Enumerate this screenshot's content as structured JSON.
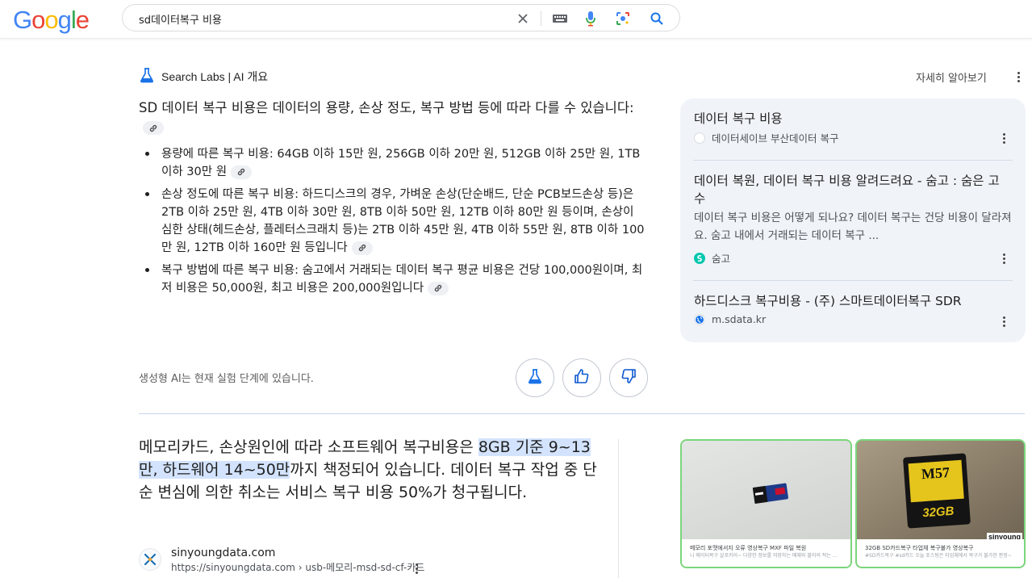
{
  "header": {
    "logo": [
      {
        "ch": "G",
        "color": "#4285F4"
      },
      {
        "ch": "o",
        "color": "#EA4335"
      },
      {
        "ch": "o",
        "color": "#FBBC05"
      },
      {
        "ch": "g",
        "color": "#4285F4"
      },
      {
        "ch": "l",
        "color": "#34A853"
      },
      {
        "ch": "e",
        "color": "#EA4335"
      }
    ],
    "search_query": "sd데이터복구 비용",
    "icons": [
      "close-icon",
      "keyboard-icon",
      "mic-icon",
      "lens-icon",
      "search-icon"
    ]
  },
  "ai_overview": {
    "label": "Search Labs | AI 개요",
    "learn_more": "자세히 알아보기",
    "summary": "SD 데이터 복구 비용은 데이터의 용량, 손상 정도, 복구 방법 등에 따라 다를 수 있습니다:",
    "bullets": [
      "용량에 따른 복구 비용: 64GB 이하 15만 원, 256GB 이하 20만 원, 512GB 이하 25만 원, 1TB 이하 30만 원",
      "손상 정도에 따른 복구 비용: 하드디스크의 경우, 가벼운 손상(단순배드, 단순 PCB보드손상 등)은 2TB 이하 25만 원, 4TB 이하 30만 원, 8TB 이하 50만 원, 12TB 이하 80만 원 등이며, 손상이 심한 상태(헤드손상, 플레터스크래치 등)는 2TB 이하 45만 원, 4TB 이하 55만 원, 8TB 이하 100만 원, 12TB 이하 160만 원 등입니다",
      "복구 방법에 따른 복구 비용: 숨고에서 거래되는 데이터 복구 평균 비용은 건당 100,000원이며, 최저 비용은 50,000원, 최고 비용은 200,000원입니다"
    ],
    "note": "생성형 AI는 현재 실험 단계에 있습니다."
  },
  "sources": [
    {
      "title": "데이터 복구 비용",
      "snippet": "",
      "site": "데이터세이브 부산데이터 복구",
      "favicon_color": "#ffffff"
    },
    {
      "title": "데이터 복원, 데이터 복구 비용 알려드려요 - 숨고 : 숨은 고수",
      "snippet": "데이터 복구 비용은 어떻게 되나요? 데이터 복구는 건당 비용이 달라져요. 숨고 내에서 거래되는 데이터 복구 ...",
      "site": "숨고",
      "favicon_color": "#00c7ae"
    },
    {
      "title": "하드디스크 복구비용 - (주) 스마트데이터복구 SDR",
      "snippet": "",
      "site": "m.sdata.kr",
      "favicon_color": "#1a73e8"
    }
  ],
  "featured": {
    "before": "메모리카드, 손상원인에 따라 소프트웨어 복구비용은 ",
    "highlight": "8GB 기준 9~13만, 하드웨어 14~50만",
    "after": "까지 책정되어 있습니다. 데이터 복구 작업 중 단순 변심에 의한 취소는 서비스 복구 비용 50%가 청구됩니다.",
    "site_name": "sinyoungdata.com",
    "site_url": "https://sinyoungdata.com › usb-메모리-msd-sd-cf-카드"
  },
  "images": [
    {
      "caption": "메모리 포맷에서지 오류 영상복구 MXF 파일 복원",
      "sub": "니 메이터복구 살포카어~ 다양한 정보를 저장하는 메체와 볼러의 적는 ..."
    },
    {
      "caption": "32GB SD카드복구 타업체 복구불가 영상복구",
      "sub": "#SD카드복구 #sd카드 오늘 포스팅은 타업체에서 복구가 불가한 판정~",
      "card_label": "M57",
      "card_size": "32GB",
      "watermark": "sinyoung"
    }
  ]
}
